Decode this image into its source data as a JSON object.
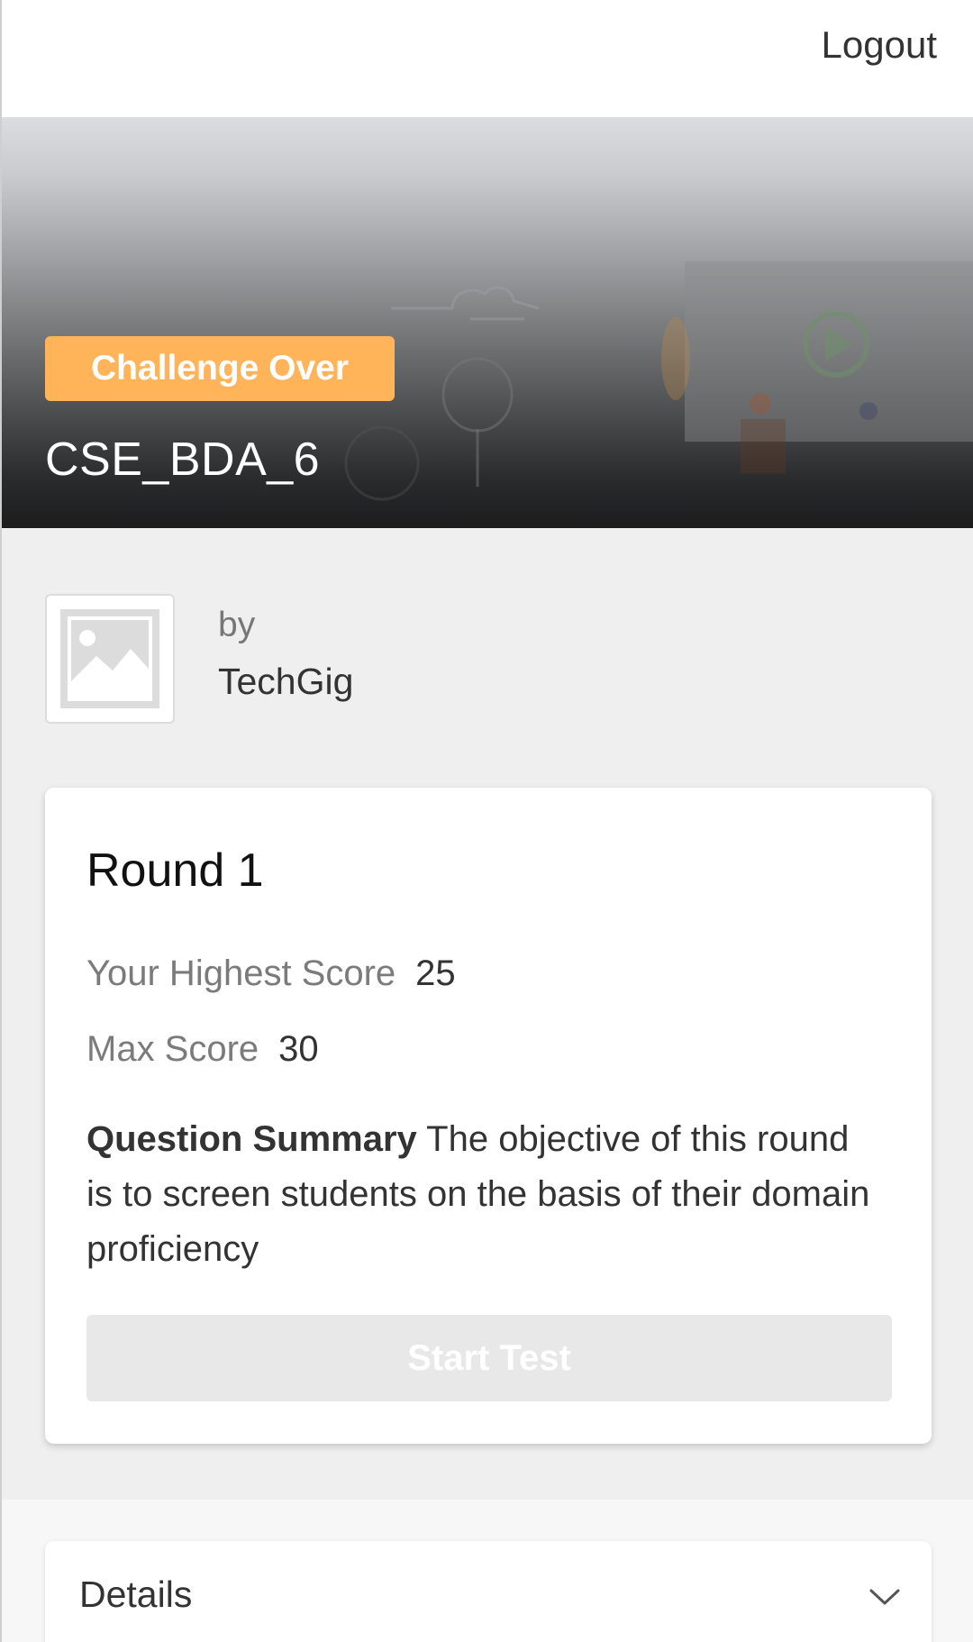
{
  "header": {
    "logout_label": "Logout"
  },
  "hero": {
    "status_badge": "Challenge Over",
    "challenge_title": "CSE_BDA_6",
    "badge_color": "#ffb45a"
  },
  "organizer": {
    "by_label": "by",
    "name": "TechGig",
    "logo_icon": "image-placeholder-icon"
  },
  "round": {
    "title": "Round 1",
    "highest_score_label": "Your Highest Score",
    "highest_score_value": "25",
    "max_score_label": "Max Score",
    "max_score_value": "30",
    "summary_label": "Question Summary",
    "summary_text": "The objective of this round is to screen students on the basis of their domain proficiency",
    "start_button_label": "Start Test"
  },
  "details": {
    "label": "Details",
    "toggle_icon": "chevron-down-icon"
  }
}
